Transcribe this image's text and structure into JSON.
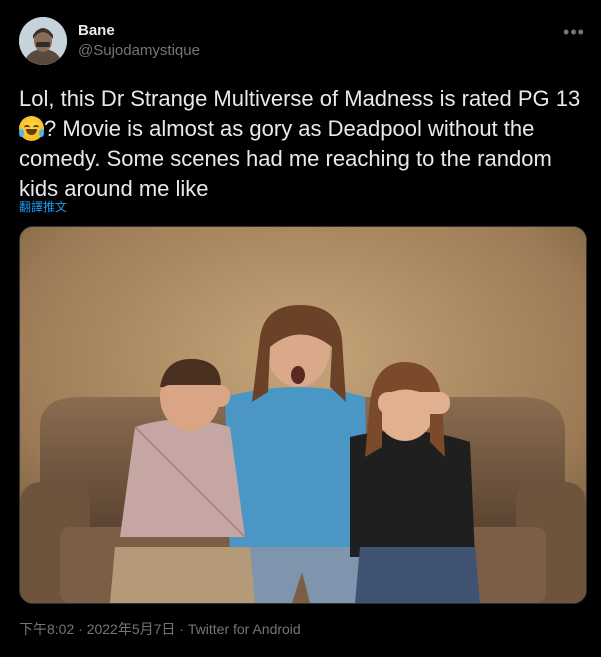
{
  "author": {
    "display_name": "Bane",
    "handle": "@Sujodamystique",
    "avatar_icon": "user-avatar"
  },
  "more_icon": "more-dots-icon",
  "tweet": {
    "text_before_emoji": "Lol, this Dr Strange Multiverse of Madness is rated PG 13",
    "emoji": "laughing-with-tears-emoji",
    "text_after_emoji": "? Movie is almost as gory as Deadpool without the comedy. Some scenes had me reaching to the random kids around me like",
    "translate_label": "翻譯推文"
  },
  "media": {
    "description_icon": "photo-woman-covering-kids-eyes"
  },
  "meta": {
    "time": "下午8:02",
    "separator1": " · ",
    "date": "2022年5月7日",
    "separator2": " · ",
    "source": "Twitter for Android"
  },
  "colors": {
    "background": "#000000",
    "text": "#e7e9ea",
    "secondary": "#71767b",
    "link": "#1d9bf0"
  }
}
